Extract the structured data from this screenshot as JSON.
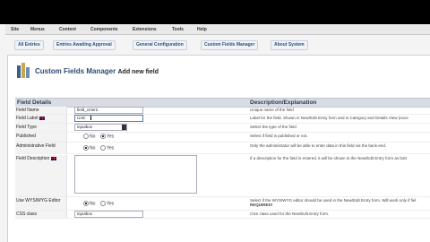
{
  "menu": [
    "Site",
    "Menus",
    "Content",
    "Components",
    "Extensions",
    "Tools",
    "Help"
  ],
  "subnav": [
    "All Entries",
    "Entries Awaiting Approval",
    "General Configuration",
    "Custom Fields Manager",
    "About System"
  ],
  "page": {
    "title": "Custom Fields Manager",
    "subtitle": "Add new field"
  },
  "table": {
    "col1": "Field Details",
    "col2": "Description/Explanation"
  },
  "rows": {
    "field_name": {
      "label": "Field Name",
      "value": "field_cmer2",
      "desc": "Unique name of the field"
    },
    "field_label": {
      "label": "Field Label",
      "value": "UAE",
      "desc": "Label for the field. Shown in New/Edit Entry form and in Category and Details View (exce"
    },
    "field_type": {
      "label": "Field Type",
      "value": "inputbox",
      "desc": "Select the type of the field"
    },
    "published": {
      "label": "Published",
      "no": "No",
      "yes": "Yes",
      "desc": "Select if field is published or not."
    },
    "admin_field": {
      "label": "Administrative Field",
      "no": "No",
      "yes": "Yes",
      "desc": "Only the administrator will be able to enter data in this field via the back-end."
    },
    "field_desc": {
      "label": "Field Description",
      "desc": "If a description for the field is entered, it will be shown in the New/Edit Entry form as bott"
    },
    "wysiwyg": {
      "label": "Use WYSIWYG Editor",
      "no": "No",
      "yes": "Yes",
      "desc": "Select if the WYSIWYG editor should be used in the New/Edit Entry form. Will work only if fiel",
      "desc2": "REQUIRED!"
    },
    "css_class": {
      "label": "CSS class",
      "value": "inputbox",
      "desc": "CSS class used for the New/Edit Entry form."
    }
  },
  "colors": {
    "title": "#2c4a73",
    "header_bg": "#d9dde3"
  }
}
